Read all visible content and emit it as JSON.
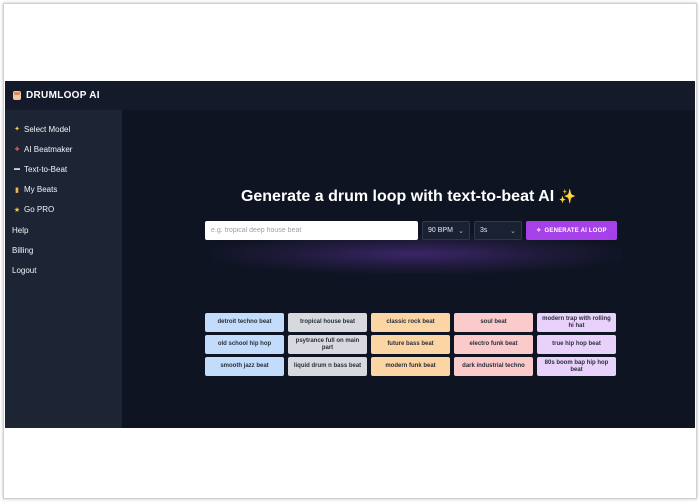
{
  "app": {
    "brand": "DRUMLOOP AI"
  },
  "sidebar": {
    "items": [
      {
        "label": "Select Model",
        "icon": "sparkle-icon"
      },
      {
        "label": "AI Beatmaker",
        "icon": "drum-icon"
      },
      {
        "label": "Text-to-Beat",
        "icon": "chat-icon"
      },
      {
        "label": "My Beats",
        "icon": "notebook-icon"
      },
      {
        "label": "Go PRO",
        "icon": "star-icon"
      },
      {
        "label": "Help"
      },
      {
        "label": "Billing"
      },
      {
        "label": "Logout"
      }
    ]
  },
  "main": {
    "headline": "Generate a drum loop with text-to-beat AI",
    "headline_emoji": "✨",
    "prompt_placeholder": "e.g. tropical deep house beat",
    "bpm": "90 BPM",
    "duration": "3s",
    "generate_label": "GENERATE AI LOOP"
  },
  "suggestions": [
    "detroit techno beat",
    "tropical house beat",
    "classic rock beat",
    "soul beat",
    "modern trap with rolling hi hat",
    "old school hip hop",
    "psytrance full on main part",
    "future bass beat",
    "electro funk beat",
    "true hip hop beat",
    "smooth jazz beat",
    "liquid drum n bass beat",
    "modern funk beat",
    "dark industrial techno",
    "80s boom bap hip hop beat"
  ],
  "colors": {
    "app_bg": "#0f1422",
    "sidebar_bg": "#1d2535",
    "accent": "#a640e8",
    "chip_blue": "#c3dcfb",
    "chip_gray": "#d7d9de",
    "chip_orange": "#fcd5a5",
    "chip_pink": "#fbcaca",
    "chip_purple": "#e8d2fb"
  }
}
